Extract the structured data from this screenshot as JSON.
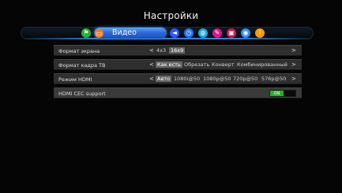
{
  "header": {
    "title": "Настройки"
  },
  "tabs": {
    "active_label": "Видео",
    "icons": [
      {
        "name": "home-icon",
        "glyph": "⚑",
        "color": "#23b52a"
      },
      {
        "name": "tv-icon",
        "glyph": "▭",
        "color": "#ff7a1a"
      },
      {
        "name": "speaker-icon",
        "glyph": "◄",
        "color": "#2f55ff"
      },
      {
        "name": "clock-icon",
        "glyph": "◷",
        "color": "#1c74ff"
      },
      {
        "name": "globe-icon",
        "glyph": "◍",
        "color": "#18a8f0"
      },
      {
        "name": "tools-icon",
        "glyph": "✎",
        "color": "#e0128c"
      },
      {
        "name": "lock-icon",
        "glyph": "▣",
        "color": "#d8124b"
      },
      {
        "name": "network-icon",
        "glyph": "◉",
        "color": "#2f8fff"
      },
      {
        "name": "info-icon",
        "glyph": "i",
        "color": "#ff9a00"
      }
    ]
  },
  "settings": {
    "screen_format": {
      "label": "Формат экрана",
      "options": [
        "4x3",
        "16x9"
      ]
    },
    "tv_frame_format": {
      "label": "Формат кадра ТВ",
      "options": [
        "Как есть",
        "Обрезать",
        "Конверт",
        "Комбинированный"
      ]
    },
    "hdmi_mode": {
      "label": "Режим HDMI",
      "options": [
        "Авто",
        "1080i@50",
        "1080p@50",
        "720p@50",
        "576p@50"
      ]
    },
    "hdmi_cec": {
      "label": "HDMI CEC support",
      "toggle_on": "ON"
    }
  },
  "arrows": {
    "left": "<",
    "right": ">"
  }
}
